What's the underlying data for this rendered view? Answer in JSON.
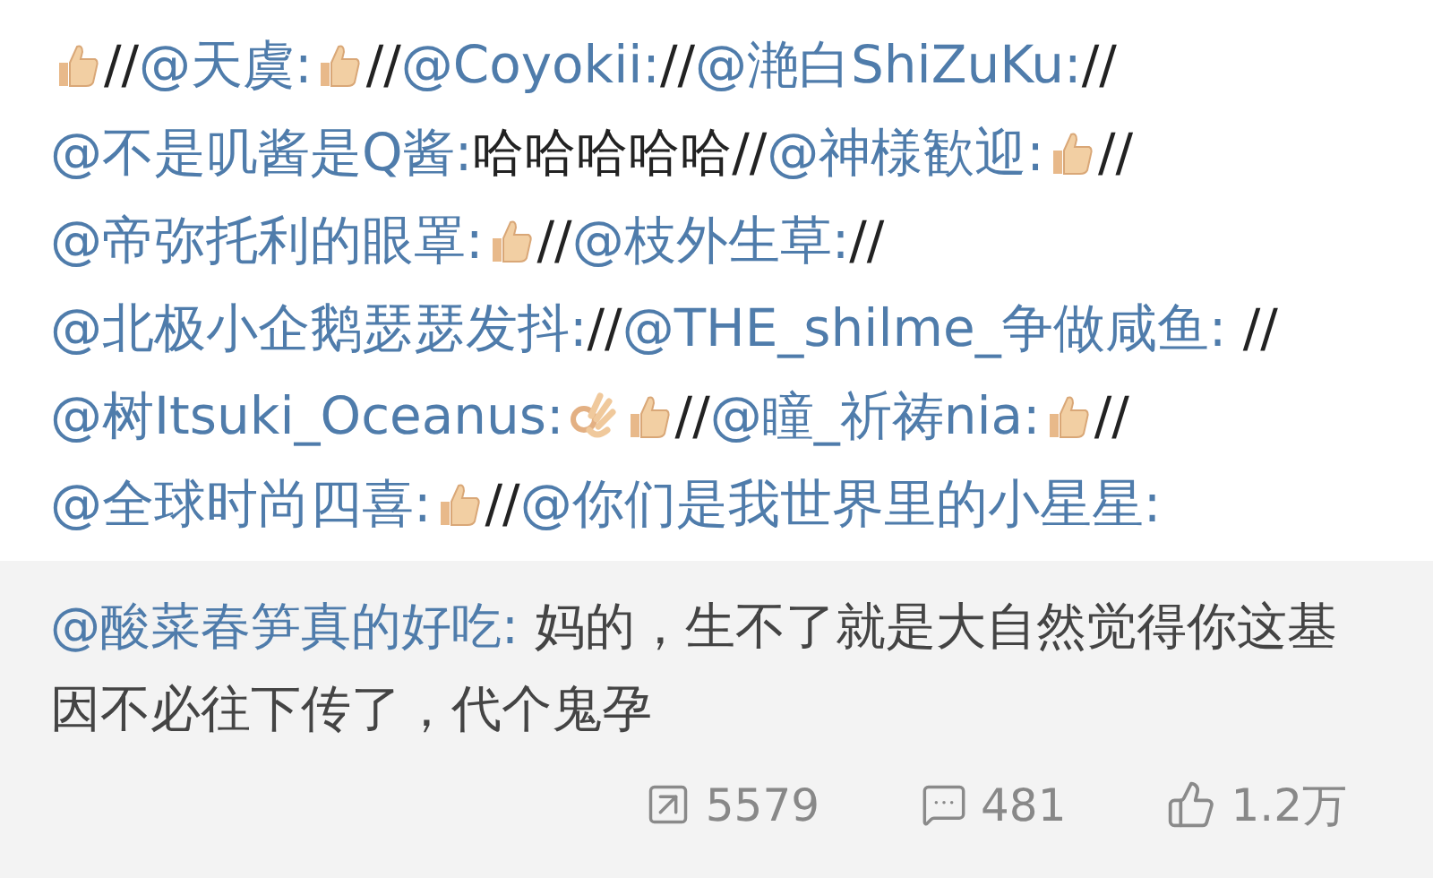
{
  "repost_chain": [
    {
      "kind": "thumb"
    },
    {
      "kind": "text",
      "text": "//"
    },
    {
      "kind": "mention",
      "text": "@天虞:"
    },
    {
      "kind": "thumb"
    },
    {
      "kind": "text",
      "text": "//"
    },
    {
      "kind": "mention",
      "text": "@Coyokii:"
    },
    {
      "kind": "text",
      "text": "//"
    },
    {
      "kind": "mention",
      "text": "@滟白ShiZuKu:"
    },
    {
      "kind": "text",
      "text": "//"
    },
    {
      "kind": "mention",
      "text": "@不是叽酱是Q酱:"
    },
    {
      "kind": "text",
      "text": "哈哈哈哈哈//"
    },
    {
      "kind": "mention",
      "text": "@神様歓迎:"
    },
    {
      "kind": "thumb"
    },
    {
      "kind": "text",
      "text": "//"
    },
    {
      "kind": "mention",
      "text": "@帝弥托利的眼罩:"
    },
    {
      "kind": "thumb"
    },
    {
      "kind": "text",
      "text": "//"
    },
    {
      "kind": "mention",
      "text": "@枝外生草:"
    },
    {
      "kind": "text",
      "text": "//"
    },
    {
      "kind": "mention",
      "text": "@北极小企鹅瑟瑟发抖:"
    },
    {
      "kind": "text",
      "text": "//"
    },
    {
      "kind": "mention",
      "text": "@THE_shilme_争做咸鱼:"
    },
    {
      "kind": "text",
      "text": " //"
    },
    {
      "kind": "mention",
      "text": "@树Itsuki_Oceanus:"
    },
    {
      "kind": "ok"
    },
    {
      "kind": "thumb"
    },
    {
      "kind": "text",
      "text": "//"
    },
    {
      "kind": "mention",
      "text": "@瞳_祈祷nia:"
    },
    {
      "kind": "thumb"
    },
    {
      "kind": "text",
      "text": "//"
    },
    {
      "kind": "mention",
      "text": "@全球时尚四喜:"
    },
    {
      "kind": "thumb"
    },
    {
      "kind": "text",
      "text": "//"
    },
    {
      "kind": "mention",
      "text": "@你们是我世界里的小星星:"
    }
  ],
  "original_post": {
    "author": "@酸菜春笋真的好吃:",
    "text": " 妈的，生不了就是大自然觉得你这基因不必往下传了，代个鬼孕"
  },
  "stats": [
    {
      "kind": "repost",
      "count": "5579"
    },
    {
      "kind": "comment",
      "count": "481"
    },
    {
      "kind": "like",
      "count": "1.2万"
    }
  ]
}
